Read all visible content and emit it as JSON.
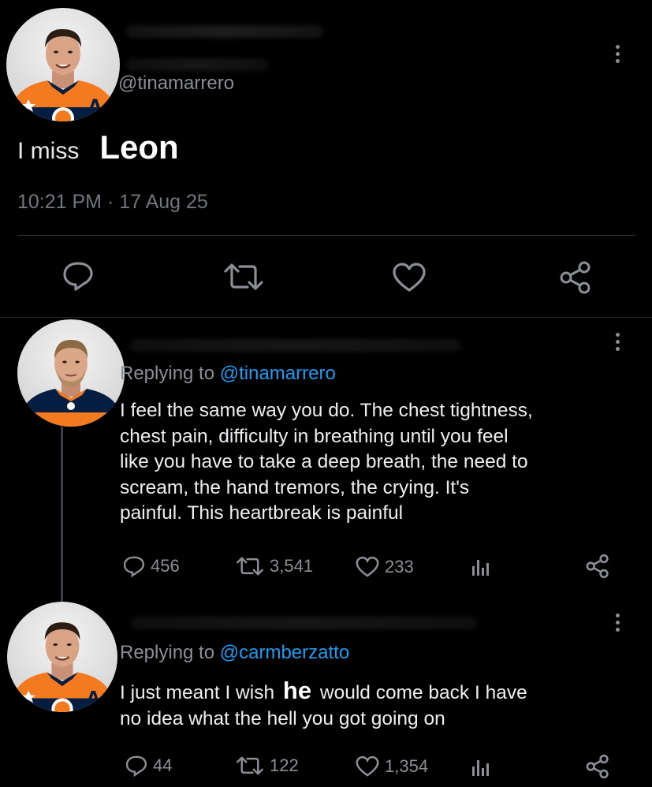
{
  "tweet1": {
    "handle": "@tinamarrero",
    "text_prefix": "I miss",
    "text_emph": "Leon",
    "timestamp": "10:21 PM · 17 Aug 25",
    "avatar_letter": "A"
  },
  "reply1": {
    "replying_label": "Replying to",
    "replying_handle": "@tinamarrero",
    "text_lines": [
      "I feel the same way you do. The chest tightness,",
      "chest pain, difficulty in breathing until you feel",
      "like you have to take a deep breath, the need to",
      "scream, the hand tremors, the crying. It's",
      "painful. This heartbreak is painful"
    ],
    "stats": {
      "replies": "456",
      "retweets": "3,541",
      "likes": "233"
    }
  },
  "reply2": {
    "replying_label": "Replying to",
    "replying_handle": "@carmberzatto",
    "line1_before": "I just meant I wish",
    "line1_emph": "he",
    "line1_after": "would come back I have",
    "line2": "no idea what the hell you got going on",
    "stats": {
      "replies": "44",
      "retweets": "122",
      "likes": "1,354"
    },
    "avatar_letter": "A"
  },
  "colors": {
    "background": "#000000",
    "link": "#1d9bf0",
    "muted": "#71767b",
    "jersey_orange": "#f47a20",
    "jersey_navy": "#041e42"
  },
  "icons": [
    "more-icon",
    "reply-icon",
    "retweet-icon",
    "like-icon",
    "share-icon",
    "analytics-icon"
  ]
}
